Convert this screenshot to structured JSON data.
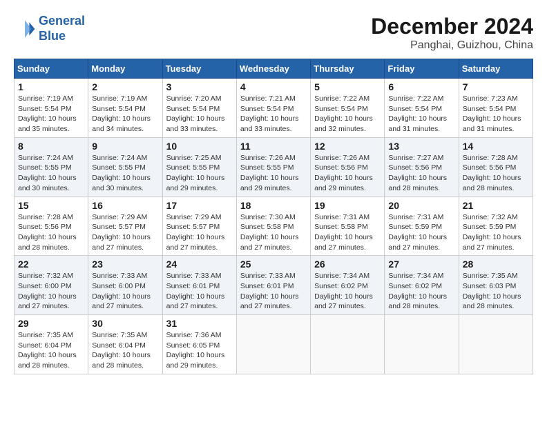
{
  "header": {
    "logo_line1": "General",
    "logo_line2": "Blue",
    "month": "December 2024",
    "location": "Panghai, Guizhou, China"
  },
  "weekdays": [
    "Sunday",
    "Monday",
    "Tuesday",
    "Wednesday",
    "Thursday",
    "Friday",
    "Saturday"
  ],
  "weeks": [
    [
      {
        "day": 1,
        "info": "Sunrise: 7:19 AM\nSunset: 5:54 PM\nDaylight: 10 hours\nand 35 minutes."
      },
      {
        "day": 2,
        "info": "Sunrise: 7:19 AM\nSunset: 5:54 PM\nDaylight: 10 hours\nand 34 minutes."
      },
      {
        "day": 3,
        "info": "Sunrise: 7:20 AM\nSunset: 5:54 PM\nDaylight: 10 hours\nand 33 minutes."
      },
      {
        "day": 4,
        "info": "Sunrise: 7:21 AM\nSunset: 5:54 PM\nDaylight: 10 hours\nand 33 minutes."
      },
      {
        "day": 5,
        "info": "Sunrise: 7:22 AM\nSunset: 5:54 PM\nDaylight: 10 hours\nand 32 minutes."
      },
      {
        "day": 6,
        "info": "Sunrise: 7:22 AM\nSunset: 5:54 PM\nDaylight: 10 hours\nand 31 minutes."
      },
      {
        "day": 7,
        "info": "Sunrise: 7:23 AM\nSunset: 5:54 PM\nDaylight: 10 hours\nand 31 minutes."
      }
    ],
    [
      {
        "day": 8,
        "info": "Sunrise: 7:24 AM\nSunset: 5:55 PM\nDaylight: 10 hours\nand 30 minutes."
      },
      {
        "day": 9,
        "info": "Sunrise: 7:24 AM\nSunset: 5:55 PM\nDaylight: 10 hours\nand 30 minutes."
      },
      {
        "day": 10,
        "info": "Sunrise: 7:25 AM\nSunset: 5:55 PM\nDaylight: 10 hours\nand 29 minutes."
      },
      {
        "day": 11,
        "info": "Sunrise: 7:26 AM\nSunset: 5:55 PM\nDaylight: 10 hours\nand 29 minutes."
      },
      {
        "day": 12,
        "info": "Sunrise: 7:26 AM\nSunset: 5:56 PM\nDaylight: 10 hours\nand 29 minutes."
      },
      {
        "day": 13,
        "info": "Sunrise: 7:27 AM\nSunset: 5:56 PM\nDaylight: 10 hours\nand 28 minutes."
      },
      {
        "day": 14,
        "info": "Sunrise: 7:28 AM\nSunset: 5:56 PM\nDaylight: 10 hours\nand 28 minutes."
      }
    ],
    [
      {
        "day": 15,
        "info": "Sunrise: 7:28 AM\nSunset: 5:56 PM\nDaylight: 10 hours\nand 28 minutes."
      },
      {
        "day": 16,
        "info": "Sunrise: 7:29 AM\nSunset: 5:57 PM\nDaylight: 10 hours\nand 27 minutes."
      },
      {
        "day": 17,
        "info": "Sunrise: 7:29 AM\nSunset: 5:57 PM\nDaylight: 10 hours\nand 27 minutes."
      },
      {
        "day": 18,
        "info": "Sunrise: 7:30 AM\nSunset: 5:58 PM\nDaylight: 10 hours\nand 27 minutes."
      },
      {
        "day": 19,
        "info": "Sunrise: 7:31 AM\nSunset: 5:58 PM\nDaylight: 10 hours\nand 27 minutes."
      },
      {
        "day": 20,
        "info": "Sunrise: 7:31 AM\nSunset: 5:59 PM\nDaylight: 10 hours\nand 27 minutes."
      },
      {
        "day": 21,
        "info": "Sunrise: 7:32 AM\nSunset: 5:59 PM\nDaylight: 10 hours\nand 27 minutes."
      }
    ],
    [
      {
        "day": 22,
        "info": "Sunrise: 7:32 AM\nSunset: 6:00 PM\nDaylight: 10 hours\nand 27 minutes."
      },
      {
        "day": 23,
        "info": "Sunrise: 7:33 AM\nSunset: 6:00 PM\nDaylight: 10 hours\nand 27 minutes."
      },
      {
        "day": 24,
        "info": "Sunrise: 7:33 AM\nSunset: 6:01 PM\nDaylight: 10 hours\nand 27 minutes."
      },
      {
        "day": 25,
        "info": "Sunrise: 7:33 AM\nSunset: 6:01 PM\nDaylight: 10 hours\nand 27 minutes."
      },
      {
        "day": 26,
        "info": "Sunrise: 7:34 AM\nSunset: 6:02 PM\nDaylight: 10 hours\nand 27 minutes."
      },
      {
        "day": 27,
        "info": "Sunrise: 7:34 AM\nSunset: 6:02 PM\nDaylight: 10 hours\nand 28 minutes."
      },
      {
        "day": 28,
        "info": "Sunrise: 7:35 AM\nSunset: 6:03 PM\nDaylight: 10 hours\nand 28 minutes."
      }
    ],
    [
      {
        "day": 29,
        "info": "Sunrise: 7:35 AM\nSunset: 6:04 PM\nDaylight: 10 hours\nand 28 minutes."
      },
      {
        "day": 30,
        "info": "Sunrise: 7:35 AM\nSunset: 6:04 PM\nDaylight: 10 hours\nand 28 minutes."
      },
      {
        "day": 31,
        "info": "Sunrise: 7:36 AM\nSunset: 6:05 PM\nDaylight: 10 hours\nand 29 minutes."
      },
      null,
      null,
      null,
      null
    ]
  ]
}
